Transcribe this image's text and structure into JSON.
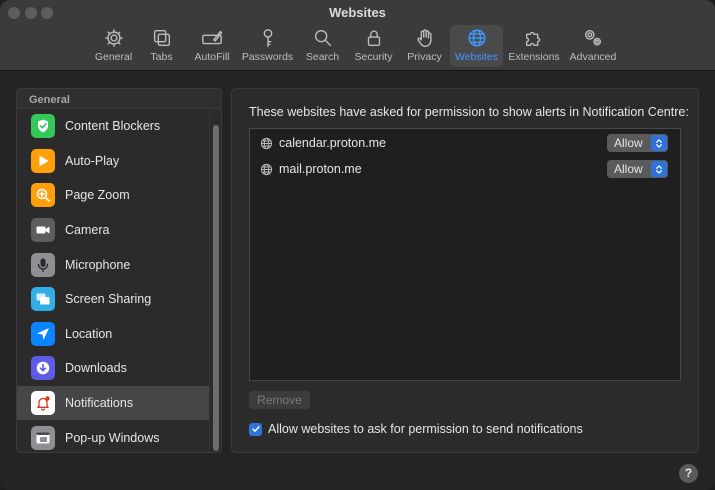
{
  "window": {
    "title": "Websites"
  },
  "toolbar": {
    "tabs": [
      {
        "label": "General",
        "icon": "gear-icon"
      },
      {
        "label": "Tabs",
        "icon": "tabs-icon"
      },
      {
        "label": "AutoFill",
        "icon": "pencil-field-icon"
      },
      {
        "label": "Passwords",
        "icon": "key-icon"
      },
      {
        "label": "Search",
        "icon": "magnifier-icon"
      },
      {
        "label": "Security",
        "icon": "lock-icon"
      },
      {
        "label": "Privacy",
        "icon": "hand-icon"
      },
      {
        "label": "Websites",
        "icon": "globe-icon",
        "active": true
      },
      {
        "label": "Extensions",
        "icon": "puzzle-icon"
      },
      {
        "label": "Advanced",
        "icon": "gears-icon"
      }
    ]
  },
  "sidebar": {
    "header": "General",
    "items": [
      {
        "label": "Content Blockers",
        "icon": "shield-check-icon",
        "color": "#34c759"
      },
      {
        "label": "Auto-Play",
        "icon": "play-icon",
        "color": "#ff9f0a"
      },
      {
        "label": "Page Zoom",
        "icon": "zoom-icon",
        "color": "#ff9f0a"
      },
      {
        "label": "Camera",
        "icon": "camera-icon",
        "color": "#5e5e60"
      },
      {
        "label": "Microphone",
        "icon": "microphone-icon",
        "color": "#8e8e93"
      },
      {
        "label": "Screen Sharing",
        "icon": "screen-sharing-icon",
        "color": "#32ade6"
      },
      {
        "label": "Location",
        "icon": "location-arrow-icon",
        "color": "#0a84ff"
      },
      {
        "label": "Downloads",
        "icon": "download-icon",
        "color": "#5e5ce6"
      },
      {
        "label": "Notifications",
        "icon": "bell-icon",
        "color": "#ffffff",
        "selected": true
      },
      {
        "label": "Pop-up Windows",
        "icon": "popup-window-icon",
        "color": "#8e8e93"
      }
    ]
  },
  "main": {
    "title": "These websites have asked for permission to show alerts in Notification Centre:",
    "sites": [
      {
        "domain": "calendar.proton.me",
        "permission": "Allow"
      },
      {
        "domain": "mail.proton.me",
        "permission": "Allow"
      }
    ],
    "remove_label": "Remove",
    "allow_ask_label": "Allow websites to ask for permission to send notifications",
    "allow_ask_checked": true
  },
  "help_label": "?",
  "colors": {
    "accent": "#2f73d9",
    "active_tab": "#3d9bff"
  }
}
